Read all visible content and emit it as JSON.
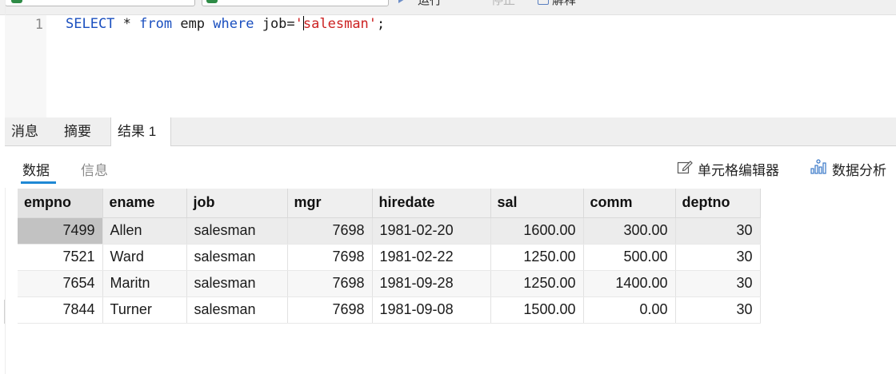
{
  "toolbar": {
    "run_label": "运行",
    "stop_label": "停止",
    "explain_label": "解释"
  },
  "editor": {
    "line_number": "1",
    "tokens": {
      "select_kw": "SELECT",
      "star": " * ",
      "from_kw": "from",
      "table": " emp ",
      "where_kw": "where",
      "cond": " job=",
      "quote_open": "'",
      "value": "salesman'",
      "end": ";"
    }
  },
  "tabs": [
    {
      "label": "消息",
      "active": false
    },
    {
      "label": "摘要",
      "active": false
    },
    {
      "label": "结果 1",
      "active": true
    }
  ],
  "subtabs": [
    {
      "label": "数据",
      "active": true
    },
    {
      "label": "信息",
      "active": false
    }
  ],
  "actions": {
    "cell_editor_label": "单元格编辑器",
    "data_analysis_label": "数据分析"
  },
  "colors": {
    "keyword": "#1a4fbf",
    "string": "#cc2222",
    "accent": "#1e88d4"
  },
  "icons": [
    "run-icon",
    "edit-cell-icon",
    "data-analysis-icon"
  ],
  "table": {
    "columns": [
      "empno",
      "ename",
      "job",
      "mgr",
      "hiredate",
      "sal",
      "comm",
      "deptno"
    ],
    "rows": [
      [
        "7499",
        "Allen",
        "salesman",
        "7698",
        "1981-02-20",
        "1600.00",
        "300.00",
        "30"
      ],
      [
        "7521",
        "Ward",
        "salesman",
        "7698",
        "1981-02-22",
        "1250.00",
        "500.00",
        "30"
      ],
      [
        "7654",
        "Maritn",
        "salesman",
        "7698",
        "1981-09-28",
        "1250.00",
        "1400.00",
        "30"
      ],
      [
        "7844",
        "Turner",
        "salesman",
        "7698",
        "1981-09-08",
        "1500.00",
        "0.00",
        "30"
      ]
    ]
  }
}
